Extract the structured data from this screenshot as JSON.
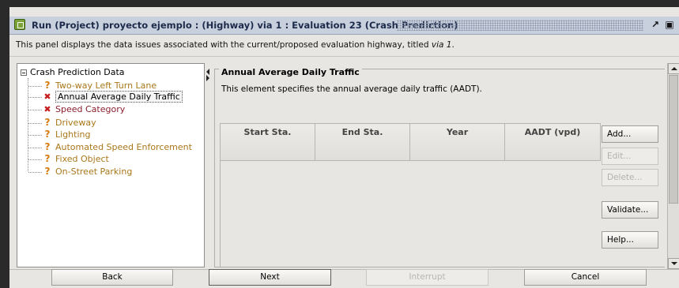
{
  "window": {
    "title": "Run (Project) proyecto ejemplo : (Highway) via 1 : Evaluation 23 (Crash Prediction)",
    "restore_icon": "restore-icon",
    "maximize_icon": "maximize-icon"
  },
  "description": {
    "text": "This panel displays the data issues associated with the current/proposed evaluation highway, titled ",
    "highway_name": "via 1",
    "suffix": "."
  },
  "tree": {
    "root_label": "Crash Prediction Data",
    "items": [
      {
        "label": "Two-way Left Turn Lane",
        "status": "warning",
        "icon": "question-icon"
      },
      {
        "label": "Annual Average Daily Traffic",
        "status": "error",
        "icon": "error-x-icon",
        "selected": true
      },
      {
        "label": "Speed Category",
        "status": "error",
        "icon": "error-x-icon"
      },
      {
        "label": "Driveway",
        "status": "warning",
        "icon": "question-icon"
      },
      {
        "label": "Lighting",
        "status": "warning",
        "icon": "question-icon"
      },
      {
        "label": "Automated Speed Enforcement",
        "status": "warning",
        "icon": "question-icon"
      },
      {
        "label": "Fixed Object",
        "status": "warning",
        "icon": "question-icon"
      },
      {
        "label": "On-Street Parking",
        "status": "warning",
        "icon": "question-icon"
      }
    ]
  },
  "detail": {
    "title": "Annual Average Daily Traffic",
    "description": "This element specifies the annual average daily traffic (AADT).",
    "columns": [
      "Start Sta.",
      "End Sta.",
      "Year",
      "AADT (vpd)"
    ]
  },
  "side_buttons": {
    "add": "Add...",
    "edit": "Edit...",
    "delete": "Delete...",
    "validate": "Validate...",
    "help": "Help..."
  },
  "nav_buttons": {
    "back": "Back",
    "next": "Next",
    "interrupt": "Interrupt",
    "cancel": "Cancel"
  },
  "colors": {
    "warning_icon": "#d57a10",
    "error_icon": "#c41c1c",
    "title_bar": "#c8d0de"
  }
}
